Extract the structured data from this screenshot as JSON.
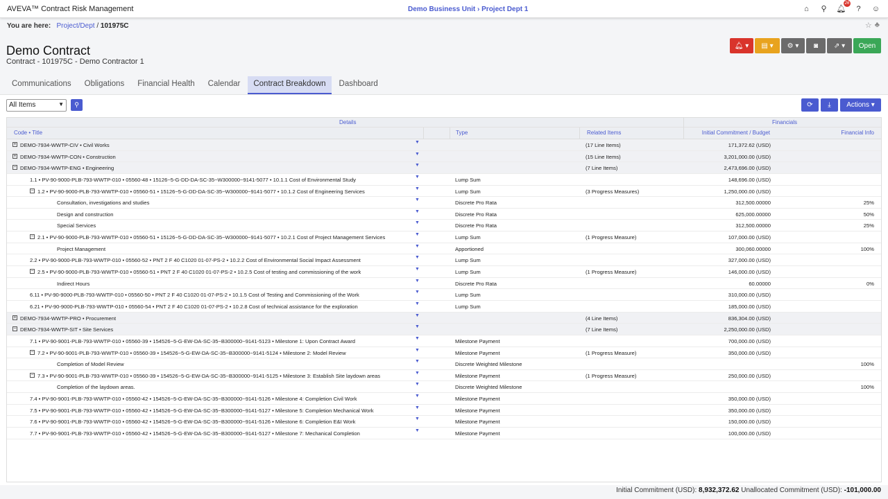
{
  "topbar": {
    "app_title": "AVEVA™ Contract Risk Management",
    "center_link": "Demo Business Unit › Project Dept 1",
    "notification_count": "26"
  },
  "breadcrumb": {
    "label": "You are here:",
    "parent": "Project/Dept",
    "separator": "/",
    "current": "101975C"
  },
  "contract": {
    "title": "Demo Contract",
    "subtitle": "Contract - 101975C - Demo Contractor 1"
  },
  "header_buttons": {
    "open_label": "Open",
    "colors": {
      "alert": "#d9342b",
      "view": "#e8a31e",
      "gray": "#6b6b6b",
      "open": "#3aa757"
    }
  },
  "tabs": [
    {
      "label": "Communications",
      "active": false
    },
    {
      "label": "Obligations",
      "active": false
    },
    {
      "label": "Financial Health",
      "active": false
    },
    {
      "label": "Calendar",
      "active": false
    },
    {
      "label": "Contract Breakdown",
      "active": true
    },
    {
      "label": "Dashboard",
      "active": false
    }
  ],
  "filter": {
    "selected": "All Items"
  },
  "actions": {
    "label": "Actions"
  },
  "grid": {
    "group_headers": {
      "details": "Details",
      "financials": "Financials"
    },
    "columns": {
      "code": "Code • Title",
      "type": "Type",
      "related": "Related Items",
      "budget": "Initial Commitment / Budget",
      "fininfo": "Financial Info"
    },
    "rows": [
      {
        "tog": "+",
        "indent": 0,
        "group": true,
        "code": "DEMO-7934-WWTP-CIV • Civil Works",
        "type": "",
        "related": "(17 Line Items)",
        "budget": "171,372.62 (USD)",
        "info": ""
      },
      {
        "tog": "+",
        "indent": 0,
        "group": true,
        "code": "DEMO-7934-WWTP-CON • Construction",
        "type": "",
        "related": "(15 Line Items)",
        "budget": "3,201,000.00 (USD)",
        "info": ""
      },
      {
        "tog": "−",
        "indent": 0,
        "group": true,
        "code": "DEMO-7934-WWTP-ENG • Engineering",
        "type": "",
        "related": "(7 Line Items)",
        "budget": "2,473,696.00 (USD)",
        "info": ""
      },
      {
        "tog": "",
        "indent": 1,
        "group": false,
        "code": "1.1 • PV-90-9000-PLB-793-WWTP-010 • 05560-48 • 15126~5-G-DD-DA-SC-35~W300000~9141-5077 • 10.1.1 Cost of Environmental Study",
        "type": "Lump Sum",
        "related": "",
        "budget": "148,696.00 (USD)",
        "info": ""
      },
      {
        "tog": "−",
        "indent": 1,
        "group": false,
        "code": "1.2 • PV-90-9000-PLB-793-WWTP-010 • 05560-51 • 15126~5-G-DD-DA-SC-35~W300000~9141-5077 • 10.1.2 Cost of Engineering Services",
        "type": "Lump Sum",
        "related": "(3 Progress Measures)",
        "budget": "1,250,000.00 (USD)",
        "info": ""
      },
      {
        "tog": "",
        "indent": 2,
        "group": false,
        "code": "Consultation, investigations and studies",
        "type": "Discrete Pro Rata",
        "related": "",
        "budget": "312,500.00000",
        "info": "25%"
      },
      {
        "tog": "",
        "indent": 2,
        "group": false,
        "code": "Design and construction",
        "type": "Discrete Pro Rata",
        "related": "",
        "budget": "625,000.00000",
        "info": "50%"
      },
      {
        "tog": "",
        "indent": 2,
        "group": false,
        "code": "Special Services",
        "type": "Discrete Pro Rata",
        "related": "",
        "budget": "312,500.00000",
        "info": "25%"
      },
      {
        "tog": "−",
        "indent": 1,
        "group": false,
        "code": "2.1 • PV-90-9000-PLB-793-WWTP-010 • 05560-51 • 15126~5-G-DD-DA-SC-35~W300000~9141-5077 • 10.2.1 Cost of Project Management Services",
        "type": "Lump Sum",
        "related": "(1 Progress Measure)",
        "budget": "107,000.00 (USD)",
        "info": ""
      },
      {
        "tog": "",
        "indent": 2,
        "group": false,
        "code": "Project Management",
        "type": "Apportioned",
        "related": "",
        "budget": "300,060.00000",
        "info": "100%"
      },
      {
        "tog": "",
        "indent": 1,
        "group": false,
        "code": "2.2 • PV-90-9000-PLB-793-WWTP-010 • 05560-52 • PNT 2 F 40 C1020 01-07-PS-2 • 10.2.2 Cost of Environmental Social Impact Assessment",
        "type": "Lump Sum",
        "related": "",
        "budget": "327,000.00 (USD)",
        "info": ""
      },
      {
        "tog": "−",
        "indent": 1,
        "group": false,
        "code": "2.5 • PV-90-9000-PLB-793-WWTP-010 • 05560-51 • PNT 2 F 40 C1020 01-07-PS-2 • 10.2.5 Cost of testing and commissioning of the work",
        "type": "Lump Sum",
        "related": "(1 Progress Measure)",
        "budget": "146,000.00 (USD)",
        "info": ""
      },
      {
        "tog": "",
        "indent": 2,
        "group": false,
        "code": "Indirect Hours",
        "type": "Discrete Pro Rata",
        "related": "",
        "budget": "60.00000",
        "info": "0%"
      },
      {
        "tog": "",
        "indent": 1,
        "group": false,
        "code": "6.11 • PV-90-9000-PLB-793-WWTP-010 • 05560-50 • PNT 2 F 40 C1020 01-07-PS-2 • 10.1.5 Cost of Testing and Commissioning of the Work",
        "type": "Lump Sum",
        "related": "",
        "budget": "310,000.00 (USD)",
        "info": ""
      },
      {
        "tog": "",
        "indent": 1,
        "group": false,
        "code": "6.21 • PV-90-9000-PLB-793-WWTP-010 • 05560-54 • PNT 2 F 40 C1020 01-07-PS-2 • 10.2.8 Cost of technical assistance for the exploration",
        "type": "Lump Sum",
        "related": "",
        "budget": "185,000.00 (USD)",
        "info": ""
      },
      {
        "tog": "+",
        "indent": 0,
        "group": true,
        "code": "DEMO-7934-WWTP-PRO • Procurement",
        "type": "",
        "related": "(4 Line Items)",
        "budget": "836,304.00 (USD)",
        "info": ""
      },
      {
        "tog": "−",
        "indent": 0,
        "group": true,
        "code": "DEMO-7934-WWTP-SIT • Site Services",
        "type": "",
        "related": "(7 Line Items)",
        "budget": "2,250,000.00 (USD)",
        "info": ""
      },
      {
        "tog": "",
        "indent": 1,
        "group": false,
        "code": "7.1 • PV-90-9001-PLB-793-WWTP-010 • 05560-39 • 154526~5-G-EW-DA-SC-35~B300000~9141-5123 • Milestone 1: Upon Contract Award",
        "type": "Milestone Payment",
        "related": "",
        "budget": "700,000.00 (USD)",
        "info": ""
      },
      {
        "tog": "−",
        "indent": 1,
        "group": false,
        "code": "7.2 • PV-90-9001-PLB-793-WWTP-010 • 05560-39 • 154526~5-G-EW-DA-SC-35~B300000~9141-5124 • Milestone 2: Model Review",
        "type": "Milestone Payment",
        "related": "(1 Progress Measure)",
        "budget": "350,000.00 (USD)",
        "info": ""
      },
      {
        "tog": "",
        "indent": 2,
        "group": false,
        "code": "Completion of Model Review",
        "type": "Discrete Weighted Milestone",
        "related": "",
        "budget": "",
        "info": "100%"
      },
      {
        "tog": "−",
        "indent": 1,
        "group": false,
        "code": "7.3 • PV-90-9001-PLB-793-WWTP-010 • 05560-39 • 154526~5-G-EW-DA-SC-35~B300000~9141-5125 • Milestone 3: Establish Site laydown areas",
        "type": "Milestone Payment",
        "related": "(1 Progress Measure)",
        "budget": "250,000.00 (USD)",
        "info": ""
      },
      {
        "tog": "",
        "indent": 2,
        "group": false,
        "code": "Completion of the laydown areas.",
        "type": "Discrete Weighted Milestone",
        "related": "",
        "budget": "",
        "info": "100%"
      },
      {
        "tog": "",
        "indent": 1,
        "group": false,
        "code": "7.4 • PV-90-9001-PLB-793-WWTP-010 • 05560-42 • 154526~5-G-EW-DA-SC-35~B300000~9141-5126 • Milestone 4: Completion Civil Work",
        "type": "Milestone Payment",
        "related": "",
        "budget": "350,000.00 (USD)",
        "info": ""
      },
      {
        "tog": "",
        "indent": 1,
        "group": false,
        "code": "7.5 • PV-90-9001-PLB-793-WWTP-010 • 05560-42 • 154526~5-G-EW-DA-SC-35~B300000~9141-5127 • Milestone 5: Completion Mechanical Work",
        "type": "Milestone Payment",
        "related": "",
        "budget": "350,000.00 (USD)",
        "info": ""
      },
      {
        "tog": "",
        "indent": 1,
        "group": false,
        "code": "7.6 • PV-90-9001-PLB-793-WWTP-010 • 05560-42 • 154526~5-G-EW-DA-SC-35~B300000~9141-5126 • Milestone 6: Completion E&I Work",
        "type": "Milestone Payment",
        "related": "",
        "budget": "150,000.00 (USD)",
        "info": ""
      },
      {
        "tog": "",
        "indent": 1,
        "group": false,
        "code": "7.7 • PV-90-9001-PLB-793-WWTP-010 • 05560-42 • 154526~5-G-EW-DA-SC-35~B300000~9141-5127 • Milestone 7: Mechanical Completion",
        "type": "Milestone Payment",
        "related": "",
        "budget": "100,000.00 (USD)",
        "info": ""
      }
    ]
  },
  "footer": {
    "initial_label": "Initial Commitment (USD):",
    "initial_value": "8,932,372.62",
    "unallocated_label": "Unallocated Commitment (USD):",
    "unallocated_value": "-101,000.00"
  }
}
